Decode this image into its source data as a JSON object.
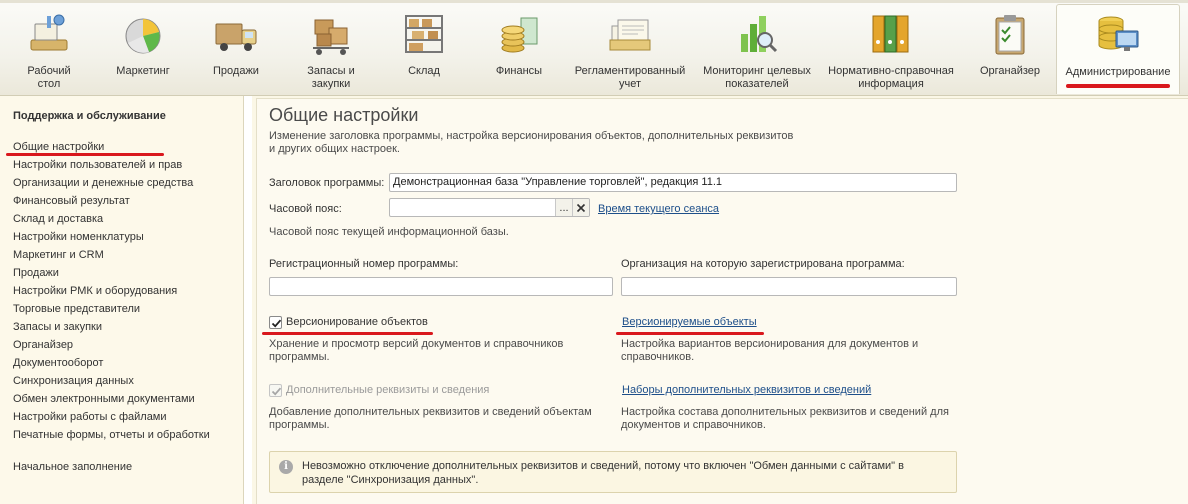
{
  "toolbar": {
    "tabs": [
      {
        "label": "Рабочий\nстол",
        "icon": "desktop-icon"
      },
      {
        "label": "Маркетинг",
        "icon": "pie-chart-icon"
      },
      {
        "label": "Продажи",
        "icon": "truck-icon"
      },
      {
        "label": "Запасы и\nзакупки",
        "icon": "boxes-cart-icon"
      },
      {
        "label": "Склад",
        "icon": "warehouse-shelf-icon"
      },
      {
        "label": "Финансы",
        "icon": "coins-icon"
      },
      {
        "label": "Регламентированный\nучет",
        "icon": "documents-icon"
      },
      {
        "label": "Мониторинг целевых\nпоказателей",
        "icon": "bar-chart-magnifier-icon"
      },
      {
        "label": "Нормативно-справочная\nинформация",
        "icon": "binders-icon"
      },
      {
        "label": "Органайзер",
        "icon": "clipboard-icon"
      },
      {
        "label": "Администрирование",
        "icon": "database-monitor-icon"
      }
    ],
    "active_tab": "Администрирование"
  },
  "sidebar": {
    "title": "Поддержка и обслуживание",
    "items": [
      "Общие настройки",
      "Настройки пользователей и прав",
      "Организации и денежные средства",
      "Финансовый результат",
      "Склад и доставка",
      "Настройки номенклатуры",
      "Маркетинг и CRM",
      "Продажи",
      "Настройки РМК и оборудования",
      "Торговые представители",
      "Запасы и закупки",
      "Органайзер",
      "Документооборот",
      "Синхронизация данных",
      "Обмен электронными документами",
      "Настройки работы с файлами",
      "Печатные формы, отчеты и обработки"
    ],
    "footer_item": "Начальное заполнение"
  },
  "main": {
    "title": "Общие настройки",
    "description": "Изменение заголовка программы, настройка версионирования объектов, дополнительных реквизитов\nи других общих настроек.",
    "program_title_label": "Заголовок программы:",
    "program_title_value": "Демонстрационная база \"Управление торговлей\", редакция 11.1",
    "timezone_label": "Часовой пояс:",
    "timezone_value": "",
    "timezone_select_button": "...",
    "session_time_link": "Время текущего сеанса",
    "timezone_hint": "Часовой пояс текущей информационной базы.",
    "reg_number_label": "Регистрационный номер программы:",
    "reg_number_value": "",
    "org_label": "Организация на которую зарегистрирована программа:",
    "org_value": "",
    "versioning_label": "Версионирование объектов",
    "versioning_checked": true,
    "versioning_desc": "Хранение и просмотр версий документов и справочников\nпрограммы.",
    "versioned_objects_link": "Версионируемые объекты",
    "versioned_objects_desc": "Настройка вариантов версионирования для документов и\nсправочников.",
    "additional_props_label": "Дополнительные реквизиты и сведения",
    "additional_props_checked": true,
    "additional_props_desc": "Добавление дополнительных реквизитов и сведений объектам\nпрограммы.",
    "props_sets_link": "Наборы дополнительных реквизитов и сведений",
    "props_sets_desc": "Настройка состава дополнительных реквизитов и сведений для\nдокументов и справочников.",
    "info_message": "Невозможно отключение дополнительных реквизитов и сведений, потому что включен \"Обмен данными с сайтами\" в\nразделе \"Синхронизация данных\"."
  },
  "colors": {
    "highlight_red": "#d9181d",
    "link": "#1e4f8a",
    "panel_bg": "#fdf9ea"
  }
}
